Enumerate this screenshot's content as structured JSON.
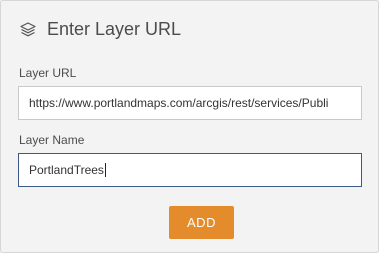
{
  "dialog": {
    "title": "Enter Layer URL",
    "icon": "layers-icon"
  },
  "form": {
    "url_label": "Layer URL",
    "url_value": "https://www.portlandmaps.com/arcgis/rest/services/Publi",
    "name_label": "Layer Name",
    "name_value": "PortlandTrees"
  },
  "actions": {
    "add_label": "ADD"
  },
  "colors": {
    "accent": "#e48b2c",
    "focus_border": "#3c5a8a"
  }
}
